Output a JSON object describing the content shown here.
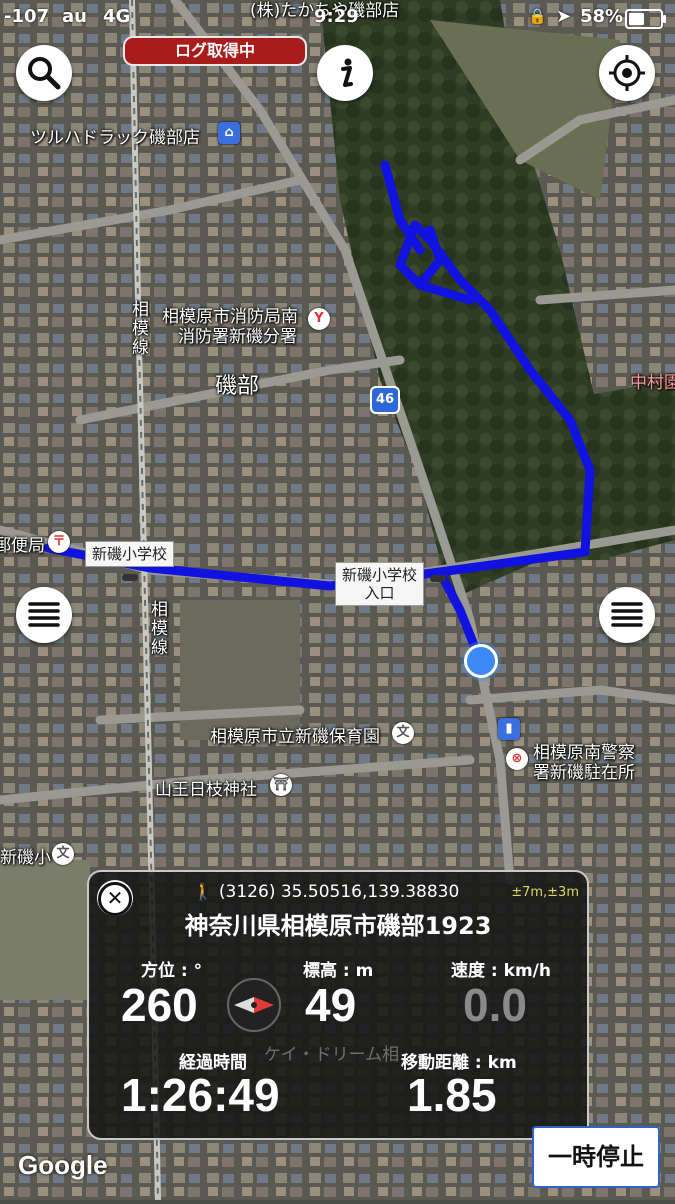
{
  "status_bar": {
    "signal": "-107",
    "carrier": "au",
    "network": "4G",
    "time": "9:29",
    "battery": "58%",
    "battery_level": 0.58
  },
  "log_badge": "ログ取得中",
  "map": {
    "labels": {
      "tsuruha": "ツルハドラック磯部店",
      "fire_station_1": "相模原市消防局南",
      "fire_station_2": "消防署新磯分署",
      "isobe": "磯部",
      "route_number": "46",
      "post_office": "郵便局",
      "school_1": "新磯小学校",
      "school_entrance_1": "新磯小学校",
      "school_entrance_2": "入口",
      "sagami_line_top": "相模線",
      "sagami_line_bottom": "相模線",
      "nursery": "相模原市立新磯保育園",
      "police_1": "相模原南警察",
      "police_2": "署新磯駐在所",
      "shrine": "山王日枝神社",
      "school_short": "新磯小",
      "nakamura": "中村園",
      "top_store": "(株)たかちや磯部店"
    }
  },
  "info_panel": {
    "coords": "(3126) 35.50516,139.38830",
    "accuracy": "±7m,±3m",
    "address": "神奈川県相模原市磯部1923",
    "bearing_label": "方位 : °",
    "bearing_value": "260",
    "altitude_label": "標高 : m",
    "altitude_value": "49",
    "speed_label": "速度 : km/h",
    "speed_value": "0.0",
    "elapsed_label": "経過時間",
    "elapsed_value": "1:26:49",
    "distance_label": "移動距離 : km",
    "distance_value": "1.85",
    "background_text": "ケイ・ドリーム相"
  },
  "pause_button": "一時停止",
  "google_logo": "Google",
  "colors": {
    "track": "#1212e0",
    "badge": "#a81c1c",
    "location": "#3b8af7"
  }
}
